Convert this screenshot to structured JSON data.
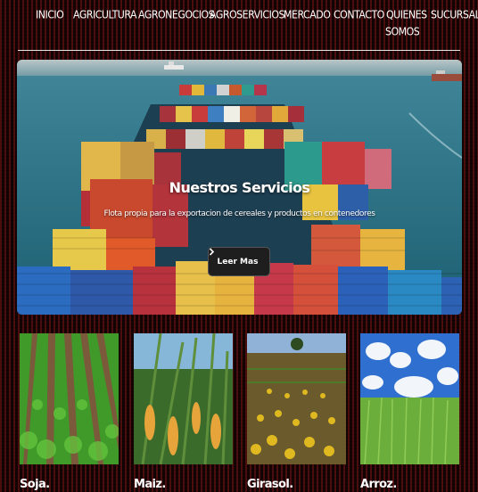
{
  "nav": {
    "items": [
      "INICIO",
      "AGRICULTURA",
      "AGRONEGOCIOS",
      "AGROSERVICIOS",
      "MERCADO",
      "CONTACTO",
      "QUIENES",
      "SUCURSALES"
    ],
    "quienes_second_line": "SOMOS"
  },
  "hero": {
    "title": "Nuestros Servicios",
    "subtitle": "Flota propia para la exportacion de cereales y productos en contenedores",
    "button_label": "Leer Mas",
    "button_icon": "chevron-right-icon"
  },
  "cards": [
    {
      "label": "Soja."
    },
    {
      "label": "Maiz."
    },
    {
      "label": "Girasol."
    },
    {
      "label": "Arroz."
    }
  ],
  "colors": {
    "background": "#140404",
    "sea": "#21677a",
    "button": "#1e1e1e"
  }
}
